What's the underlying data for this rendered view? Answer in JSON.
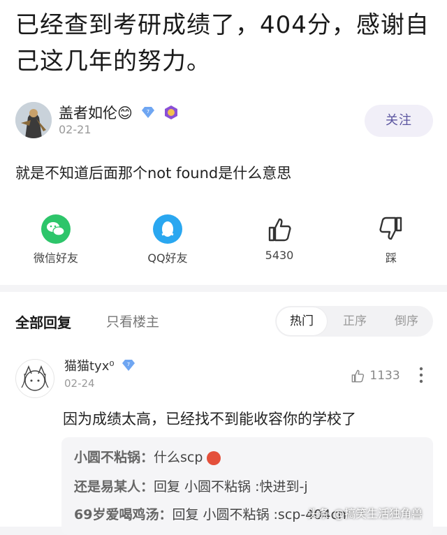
{
  "post": {
    "title": "已经查到考研成绩了，404分，感谢自己这几年的努力。",
    "author": {
      "name": "盖者如伦😊",
      "date": "02-21",
      "follow_label": "关注"
    },
    "body": "就是不知道后面那个not found是什么意思",
    "actions": {
      "wechat_label": "微信好友",
      "qq_label": "QQ好友",
      "like_count": "5430",
      "dislike_label": "踩"
    }
  },
  "replies": {
    "tab_all": "全部回复",
    "tab_op_only": "只看楼主",
    "sort": {
      "hot": "热门",
      "asc": "正序",
      "desc": "倒序"
    },
    "items": [
      {
        "name": "猫猫tyx⁰",
        "date": "02-24",
        "likes": "1133",
        "text": "因为成绩太高，已经找不到能收容你的学校了",
        "sub_replies": [
          {
            "who": "小圆不粘锅：",
            "text": "什么scp"
          },
          {
            "who": "还是易某人：",
            "text": "回复 小圆不粘锅 :快进到-j"
          },
          {
            "who": "69岁爱喝鸡汤：",
            "text": "回复 小圆不粘锅 :scp-404cn"
          }
        ]
      }
    ]
  },
  "watermark": "头条 @搞笑生活独角兽",
  "colors": {
    "accent": "#5b55a0",
    "wechat": "#2dc56a",
    "qq": "#2aa7f0"
  }
}
